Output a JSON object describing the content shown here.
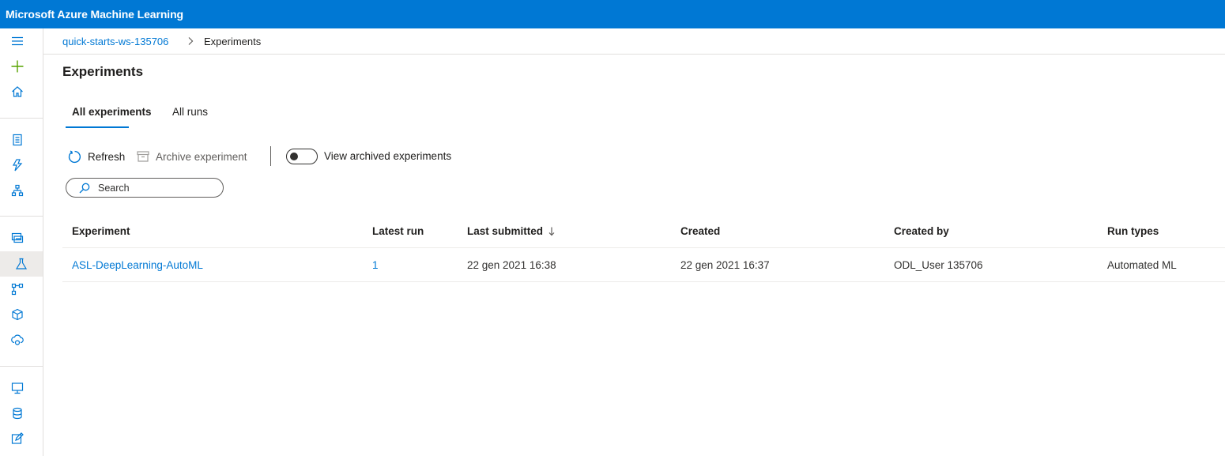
{
  "app": {
    "title": "Microsoft Azure Machine Learning"
  },
  "nav": {
    "icons": [
      "menu-icon",
      "add-icon",
      "home-icon",
      "notebook-icon",
      "automl-icon",
      "designer-icon",
      "datasets-icon",
      "experiments-icon",
      "pipelines-icon",
      "models-icon",
      "endpoints-icon",
      "compute-icon",
      "datastores-icon",
      "data-labeling-icon"
    ],
    "selected": "experiments-icon"
  },
  "breadcrumb": {
    "workspace": "quick-starts-ws-135706",
    "current": "Experiments"
  },
  "page": {
    "title": "Experiments"
  },
  "tabs": {
    "all_experiments": "All experiments",
    "all_runs": "All runs",
    "active": "All experiments"
  },
  "toolbar": {
    "refresh_label": "Refresh",
    "archive_label": "Archive experiment",
    "view_archived_label": "View archived experiments",
    "view_archived_on": false
  },
  "search": {
    "placeholder": "Search"
  },
  "table": {
    "columns": [
      "Experiment",
      "Latest run",
      "Last submitted",
      "Created",
      "Created by",
      "Run types"
    ],
    "sort_column": "Last submitted",
    "sort_direction": "descending",
    "rows": [
      {
        "experiment": "ASL-DeepLearning-AutoML",
        "latest_run": "1",
        "last_submitted": "22 gen 2021 16:38",
        "created": "22 gen 2021 16:37",
        "created_by": "ODL_User 135706",
        "run_types": "Automated ML"
      }
    ]
  },
  "colors": {
    "brand": "#0078d4",
    "add": "#57a300",
    "text": "#201f1e",
    "border": "#e1dfdd"
  }
}
